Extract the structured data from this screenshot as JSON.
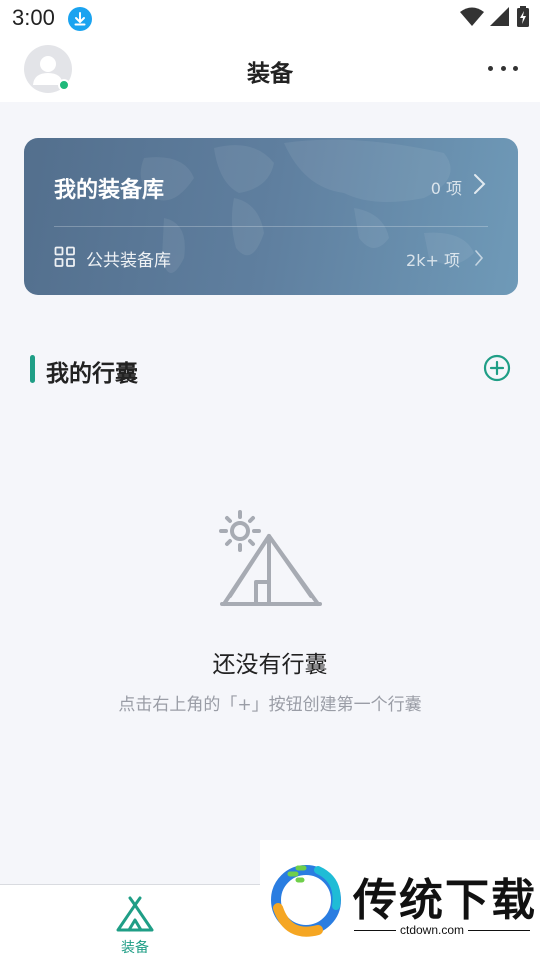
{
  "status_bar": {
    "time": "3:00",
    "download_icon": "download-icon",
    "wifi_icon": "wifi-icon",
    "signal_icon": "signal-icon",
    "battery_icon": "battery-icon"
  },
  "header": {
    "title": "装备",
    "avatar_icon": "person-icon",
    "more_icon": "more-horizontal-icon",
    "online_color": "#1fb97a"
  },
  "card": {
    "my_library_label": "我的装备库",
    "my_library_count": "0 项",
    "public_library_label": "公共装备库",
    "public_library_count": "2k+ 项",
    "public_icon": "grid-apps-icon",
    "chevron_icon": "chevron-right-icon"
  },
  "section": {
    "title": "我的行囊",
    "add_icon": "plus-circle-icon",
    "accent": "#1f9e86"
  },
  "empty_state": {
    "illustration": "tent-sun-icon",
    "title": "还没有行囊",
    "subtitle": "点击右上角的「+」按钮创建第一个行囊"
  },
  "tab_bar": {
    "items": [
      {
        "label": "装备",
        "icon": "tent-icon",
        "active": true
      }
    ],
    "active_color": "#1f9e86"
  },
  "watermark": {
    "brand": "传统下载",
    "url": "ctdown.com"
  }
}
